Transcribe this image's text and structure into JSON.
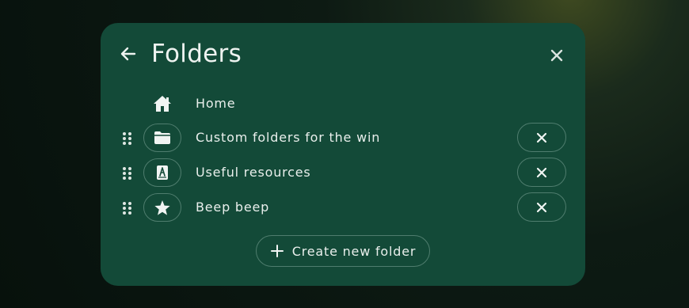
{
  "header": {
    "title": "Folders",
    "back_icon": "arrow-left-icon",
    "close_icon": "close-icon"
  },
  "folders": [
    {
      "label": "Home",
      "icon": "home-icon",
      "removable": false,
      "draggable": false
    },
    {
      "label": "Custom folders for the win",
      "icon": "folder-icon",
      "removable": true,
      "draggable": true
    },
    {
      "label": "Useful resources",
      "icon": "notebook-icon",
      "removable": true,
      "draggable": true
    },
    {
      "label": "Beep beep",
      "icon": "star-icon",
      "removable": true,
      "draggable": true
    }
  ],
  "create_button": {
    "label": "Create new folder",
    "icon": "plus-icon"
  },
  "colors": {
    "dialog_bg": "#134a38",
    "border": "#4f7d6e",
    "text": "#e9efec"
  }
}
